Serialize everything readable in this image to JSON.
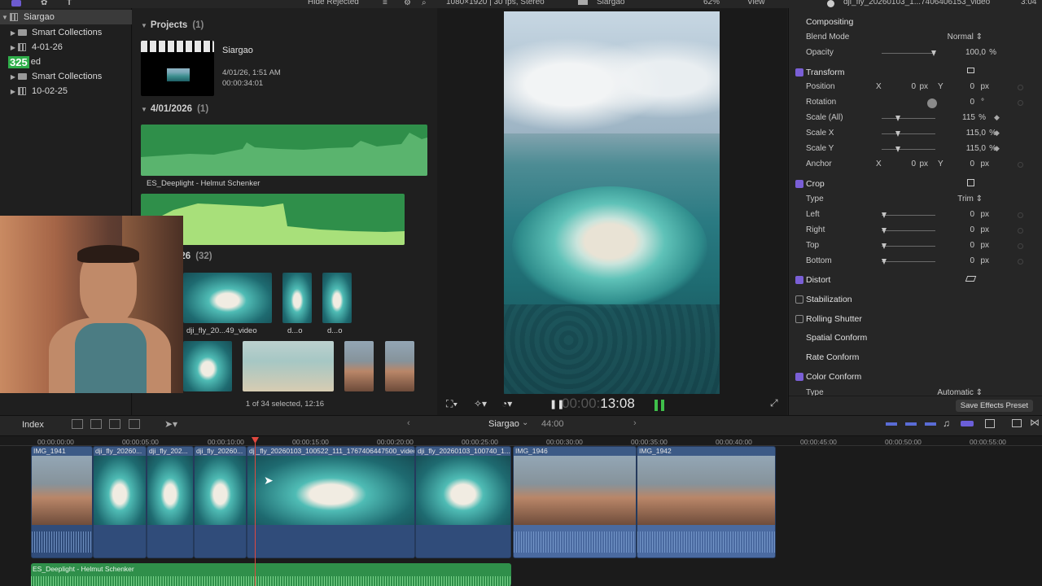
{
  "topbar": {
    "filter_label": "Hide Rejected",
    "viewer_format": "1080×1920 | 30 fps, Stereo",
    "viewer_title": "Siargao",
    "zoom": "62%",
    "view_label": "View",
    "inspector_clip": "dji_fly_20260103_1...7406406153_video",
    "inspector_dur": "3:04"
  },
  "sidebar": {
    "items": [
      {
        "label": "Siargao"
      },
      {
        "label": "Smart Collections"
      },
      {
        "label": "4-01-26"
      },
      {
        "label": "ed"
      },
      {
        "label": "Smart Collections"
      },
      {
        "label": "10-02-25"
      }
    ],
    "badge": "325"
  },
  "browser": {
    "projects_header": "Projects",
    "projects_count": "(1)",
    "project_name": "Siargao",
    "project_date": "4/01/26, 1:51 AM",
    "project_dur": "00:00:34:01",
    "section2_header": "4/01/2026",
    "section2_count": "(1)",
    "audio1_name": "ES_Deeplight - Helmut Schenker",
    "section3_header": "026",
    "section3_count": "(32)",
    "clips": [
      {
        "label": "dji_fly_20...49_video"
      },
      {
        "label": "d...o"
      },
      {
        "label": "d...o"
      }
    ],
    "selection_status": "1 of 34 selected, 12:16"
  },
  "viewer": {
    "timecode_dim": "00:00:",
    "timecode": "13:08"
  },
  "inspector": {
    "compositing": "Compositing",
    "blend_label": "Blend Mode",
    "blend_value": "Normal ⇕",
    "opacity_label": "Opacity",
    "opacity_value": "100,0",
    "opacity_unit": "%",
    "transform": "Transform",
    "position_label": "Position",
    "pos_x_label": "X",
    "pos_x": "0",
    "pos_x_unit": "px",
    "pos_y_label": "Y",
    "pos_y": "0",
    "pos_y_unit": "px",
    "rotation_label": "Rotation",
    "rotation_value": "0",
    "rotation_unit": "°",
    "scale_all_label": "Scale (All)",
    "scale_all": "115",
    "scale_all_unit": "%",
    "scale_x_label": "Scale X",
    "scale_x": "115,0",
    "scale_x_unit": "%",
    "scale_y_label": "Scale Y",
    "scale_y": "115,0",
    "scale_y_unit": "%",
    "anchor_label": "Anchor",
    "anc_x_label": "X",
    "anc_x": "0",
    "anc_x_unit": "px",
    "anc_y_label": "Y",
    "anc_y": "0",
    "anc_y_unit": "px",
    "crop": "Crop",
    "type_label": "Type",
    "type_value": "Trim ⇕",
    "left_label": "Left",
    "left": "0",
    "left_unit": "px",
    "right_label": "Right",
    "right": "0",
    "right_unit": "px",
    "top_label": "Top",
    "top": "0",
    "top_unit": "px",
    "bottom_label": "Bottom",
    "bottom": "0",
    "bottom_unit": "px",
    "distort": "Distort",
    "stabilization": "Stabilization",
    "rolling_shutter": "Rolling Shutter",
    "spatial_conform": "Spatial Conform",
    "rate_conform": "Rate Conform",
    "color_conform": "Color Conform",
    "cc_type_label": "Type",
    "cc_type_value": "Automatic ⇕",
    "save_preset": "Save Effects Preset"
  },
  "toolbar": {
    "index_label": "Index",
    "project_name": "Siargao",
    "duration": "44:00"
  },
  "timeline": {
    "ruler": [
      "00:00:00:00",
      "00:00:05:00",
      "00:00:10:00",
      "00:00:15:00",
      "00:00:20:00",
      "00:00:25:00",
      "00:00:30:00",
      "00:00:35:00",
      "00:00:40:00",
      "00:00:45:00",
      "00:00:50:00",
      "00:00:55:00"
    ],
    "clips": [
      {
        "name": "IMG_1941"
      },
      {
        "name": "dji_fly_20260..."
      },
      {
        "name": "dji_fly_202..."
      },
      {
        "name": "dji_fly_20260..."
      },
      {
        "name": "dji_fly_20260103_100522_111_1767406447500_video"
      },
      {
        "name": "dji_fly_20260103_100740_1..."
      },
      {
        "name": "IMG_1946"
      },
      {
        "name": "IMG_1942"
      }
    ],
    "music_name": "ES_Deeplight - Helmut Schenker"
  },
  "colors": {
    "accent": "#7a5fd6",
    "clip_blue": "#3c5a86",
    "audio_green": "#2f8f4a",
    "playhead": "#e0483f"
  }
}
